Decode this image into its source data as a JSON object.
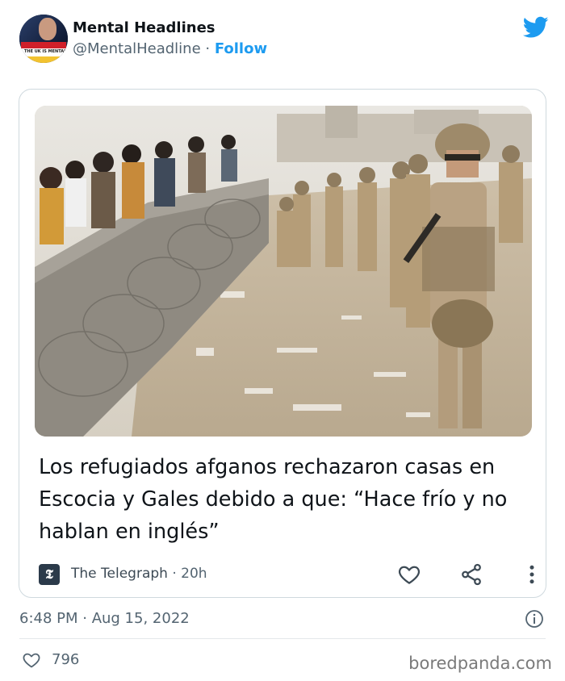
{
  "account": {
    "name": "Mental Headlines",
    "handle": "@MentalHeadline",
    "separator": " · ",
    "follow_label": "Follow",
    "avatar_text": "THE UK IS MENTAL"
  },
  "card": {
    "headline": "Los refugiados afganos rechazaron casas en Escocia y Gales debido a que: “Hace frío y no hablan en inglés”",
    "source_name": "The Telegraph",
    "source_separator": " · ",
    "source_time": "20h",
    "source_logo_icon": "telegraph-logo-icon",
    "photo_subject": "soldiers-and-refugees-photo"
  },
  "tweet": {
    "timestamp": "6:48 PM · Aug 15, 2022",
    "likes": "796"
  },
  "watermark": "boredpanda.com",
  "colors": {
    "accent": "#1d9bf0",
    "text_primary": "#0f1419",
    "text_secondary": "#536471",
    "border": "#cfd9de"
  },
  "icons": [
    "twitter-bird-icon",
    "heart-icon",
    "share-icon",
    "more-vertical-icon",
    "info-icon"
  ]
}
